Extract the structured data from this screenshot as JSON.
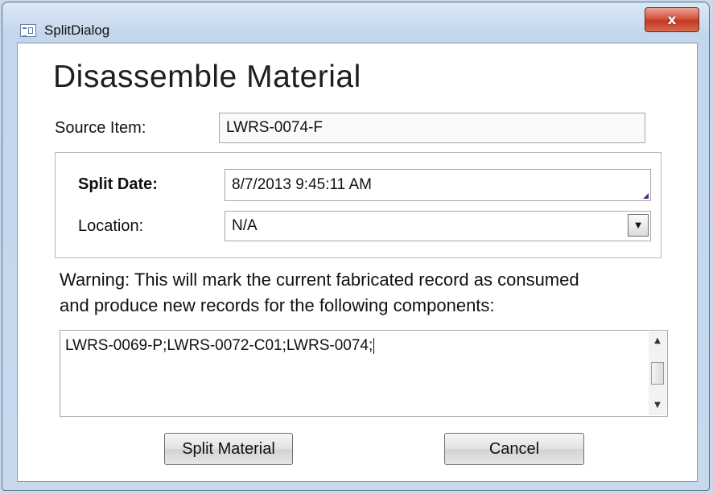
{
  "window": {
    "title": "SplitDialog",
    "close_label": "x"
  },
  "form": {
    "heading": "Disassemble Material",
    "source_item_label": "Source Item:",
    "source_item_value": "LWRS-0074-F",
    "split_date_label": "Split Date:",
    "split_date_value": "8/7/2013 9:45:11 AM",
    "location_label": "Location:",
    "location_value": "N/A",
    "warning_line1": "Warning: This will mark the current fabricated record as consumed",
    "warning_line2": "and produce new records for the following components:",
    "components_value": "LWRS-0069-P;LWRS-0072-C01;LWRS-0074;"
  },
  "buttons": {
    "split_label": "Split Material",
    "cancel_label": "Cancel"
  },
  "icons": {
    "app": "form-icon",
    "close": "close-icon",
    "dropdown": "chevron-down-icon",
    "scroll_up": "scroll-up-arrow-icon",
    "scroll_down": "scroll-down-arrow-icon"
  },
  "colors": {
    "close_button": "#c23a22",
    "window_frame": "#c4d6ec"
  }
}
